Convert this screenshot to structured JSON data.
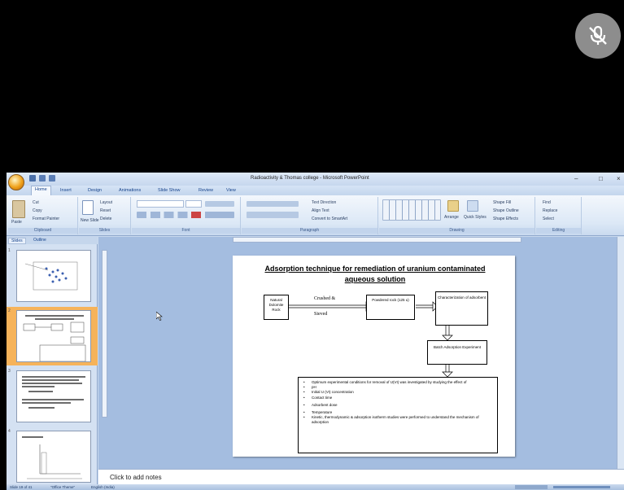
{
  "window": {
    "title": "Radioactivity & Thomas college - Microsoft PowerPoint"
  },
  "ribbon": {
    "tabs": [
      "Home",
      "Insert",
      "Design",
      "Animations",
      "Slide Show",
      "Review",
      "View"
    ],
    "active_tab": "Home",
    "groups": {
      "clipboard": {
        "label": "Clipboard",
        "paste": "Paste",
        "cut": "Cut",
        "copy": "Copy",
        "format_painter": "Format Painter"
      },
      "slides": {
        "label": "Slides",
        "new_slide": "New Slide",
        "layout": "Layout",
        "reset": "Reset",
        "delete": "Delete"
      },
      "font": {
        "label": "Font"
      },
      "paragraph": {
        "label": "Paragraph",
        "text_direction": "Text Direction",
        "align_text": "Align Text",
        "convert_smartart": "Convert to SmartArt"
      },
      "drawing": {
        "label": "Drawing",
        "arrange": "Arrange",
        "quick_styles": "Quick Styles",
        "shape_fill": "Shape Fill",
        "shape_outline": "Shape Outline",
        "shape_effects": "Shape Effects"
      },
      "editing": {
        "label": "Editing",
        "find": "Find",
        "replace": "Replace",
        "select": "Select"
      }
    }
  },
  "panel": {
    "tabs": [
      "Slides",
      "Outline"
    ],
    "active_tab": "Slides",
    "thumbnail_numbers": [
      "1",
      "2",
      "3",
      "4"
    ],
    "selected_index": 1
  },
  "slide": {
    "title": "Adsorption technique for remediation of uranium contaminated aqueous solution",
    "boxes": {
      "natural": "Natural Dolomite Rock",
      "powdered": "Powdered rock (125 u)",
      "characterization": "Characterization of adsorbent",
      "batch": "Batch Adsorption Experiment"
    },
    "arrow_text_top": "Crushed &",
    "arrow_text_bottom": "Sieved",
    "bullets": [
      {
        "mark": "•",
        "text": "Optimum experimental conditions for removal of U(VI) was investigated by studying the effect of"
      },
      {
        "mark": "•",
        "text": "pH"
      },
      {
        "mark": "•",
        "text": "Initial U (VI) concentration"
      },
      {
        "mark": "•",
        "text": "Contact time"
      },
      {
        "mark": "•",
        "text": "Adsorbent dose"
      },
      {
        "mark": "•",
        "text": "Temperature"
      },
      {
        "mark": "•",
        "text": "Kinetic, thermodynamic & adsorption isotherm studies were performed to understand the mechanism of adsorption"
      }
    ]
  },
  "notes": {
    "placeholder": "Click to add notes"
  },
  "statusbar": {
    "slide_info": "Slide 19 of 41",
    "theme": "\"Office Theme\"",
    "language": "English (India)"
  },
  "colors": {
    "ribbon_text": "#15428b",
    "selected_thumb": "#f6b35a",
    "work_area": "#a4bde0"
  }
}
